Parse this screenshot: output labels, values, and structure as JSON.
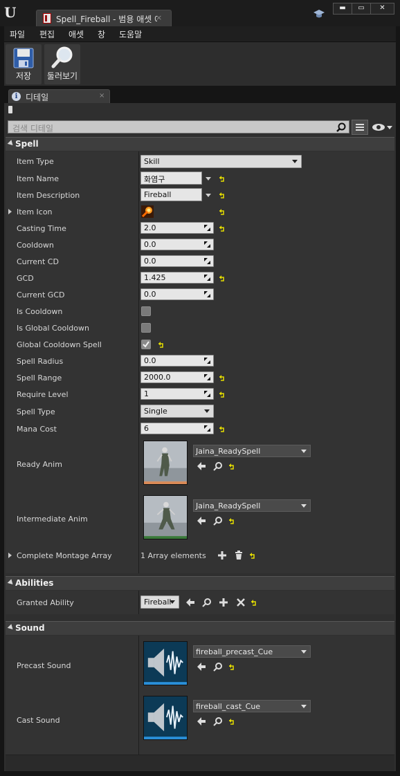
{
  "window": {
    "tab_title": "Spell_Fireball - 범용 애셋 에",
    "tab_close": "×",
    "min_glyph": "▬",
    "max_glyph": "▭",
    "close_glyph": "✕"
  },
  "menu": [
    "파일",
    "편집",
    "애셋",
    "창",
    "도움말"
  ],
  "toolbar": {
    "save_label": "저장",
    "browse_label": "둘러보기"
  },
  "panel": {
    "title": "디테일",
    "close": "×",
    "search_placeholder": "검색 디테일"
  },
  "spell": {
    "header": "Spell",
    "item_type": {
      "label": "Item Type",
      "value": "Skill"
    },
    "item_name": {
      "label": "Item Name",
      "value": "화염구"
    },
    "item_description": {
      "label": "Item Description",
      "value": "Fireball"
    },
    "item_icon": {
      "label": "Item Icon"
    },
    "casting_time": {
      "label": "Casting Time",
      "value": "2.0"
    },
    "cooldown": {
      "label": "Cooldown",
      "value": "0.0"
    },
    "current_cd": {
      "label": "Current CD",
      "value": "0.0"
    },
    "gcd": {
      "label": "GCD",
      "value": "1.425"
    },
    "current_gcd": {
      "label": "Current GCD",
      "value": "0.0"
    },
    "is_cooldown": {
      "label": "Is Cooldown",
      "checked": false
    },
    "is_global_cooldown": {
      "label": "Is Global Cooldown",
      "checked": false
    },
    "global_cooldown_spell": {
      "label": "Global Cooldown Spell",
      "checked": true
    },
    "spell_radius": {
      "label": "Spell Radius",
      "value": "0.0"
    },
    "spell_range": {
      "label": "Spell Range",
      "value": "2000.0"
    },
    "require_level": {
      "label": "Require Level",
      "value": "1"
    },
    "spell_type": {
      "label": "Spell Type",
      "value": "Single"
    },
    "mana_cost": {
      "label": "Mana Cost",
      "value": "6"
    },
    "ready_anim": {
      "label": "Ready Anim",
      "value": "Jaina_ReadySpell"
    },
    "intermediate_anim": {
      "label": "Intermediate Anim",
      "value": "Jaina_ReadySpell"
    },
    "complete_montage": {
      "label": "Complete Montage Array",
      "value": "1 Array elements"
    }
  },
  "abilities": {
    "header": "Abilities",
    "granted_ability": {
      "label": "Granted Ability",
      "value": "Fireball"
    }
  },
  "sound": {
    "header": "Sound",
    "precast": {
      "label": "Precast Sound",
      "value": "fireball_precast_Cue"
    },
    "cast": {
      "label": "Cast Sound",
      "value": "fireball_cast_Cue"
    }
  },
  "colors": {
    "reset_arrow": "#e8e000",
    "thumb_bar_anim_1": "#d98a57",
    "thumb_bar_anim_2": "#3a7a3a",
    "thumb_bar_sound": "#2a8fd8"
  }
}
